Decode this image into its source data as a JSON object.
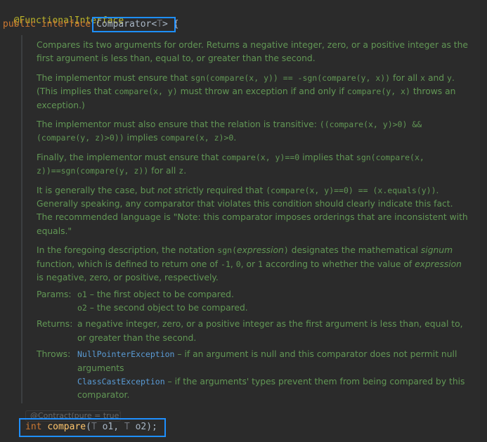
{
  "editor": {
    "annotation": "@FunctionalInterface",
    "decl_keyword1": "public",
    "decl_keyword2": "interface",
    "class_name": "Comparator",
    "type_param_open": "<",
    "type_param": "T",
    "type_param_close": ">",
    "brace": " {",
    "contract_hint": "@Contract(pure = true)",
    "method_return_type": "int",
    "method_name": "compare",
    "method_paren_open": "(",
    "param1_type": "T",
    "param1_name": "o1",
    "comma": ", ",
    "param2_type": "T",
    "param2_name": "o2",
    "method_end": ");"
  },
  "doc": {
    "p1": "Compares its two arguments for order. Returns a negative integer, zero, or a positive integer as the first argument is less than, equal to, or greater than the second.",
    "p2_a": "The implementor must ensure that ",
    "p2_code1": "sgn(compare(x, y)) == -sgn(compare(y, x))",
    "p2_b": " for all ",
    "p2_c1": "x",
    "p2_and": " and ",
    "p2_c2": "y",
    "p2_c": ". (This implies that ",
    "p2_code2": "compare(x, y)",
    "p2_d": " must throw an exception if and only if ",
    "p2_code3": "compare(y, x)",
    "p2_e": " throws an exception.)",
    "p3_a": "The implementor must also ensure that the relation is transitive: ",
    "p3_code1": "((compare(x, y)>0) && (compare(y, z)>0))",
    "p3_b": " implies ",
    "p3_code2": "compare(x, z)>0",
    "p3_c": ".",
    "p4_a": "Finally, the implementor must ensure that ",
    "p4_code1": "compare(x, y)==0",
    "p4_b": " implies that ",
    "p4_code2": "sgn(compare(x, z))==sgn(compare(y, z))",
    "p4_c": " for all ",
    "p4_code3": "z",
    "p4_d": ".",
    "p5_a": "It is generally the case, but ",
    "p5_em": "not",
    "p5_b": " strictly required that ",
    "p5_code1": "(compare(x, y)==0) == (x.equals(y))",
    "p5_c": ". Generally speaking, any comparator that violates this condition should clearly indicate this fact. The recommended language is \"Note: this comparator imposes orderings that are inconsistent with equals.\"",
    "p6_a": "In the foregoing description, the notation ",
    "p6_code1": "sgn(",
    "p6_em1": "expression",
    "p6_code2": ")",
    "p6_b": " designates the mathematical ",
    "p6_em2": "signum",
    "p6_c": " function, which is defined to return one of ",
    "p6_code3": "-1",
    "p6_d": ", ",
    "p6_code4": "0",
    "p6_e": ", or ",
    "p6_code5": "1",
    "p6_f": " according to whether the value of ",
    "p6_em3": "expression",
    "p6_g": " is negative, zero, or positive, respectively.",
    "params_label": "Params:",
    "param1_name": "o1",
    "param1_desc": " – the first object to be compared.",
    "param2_name": "o2",
    "param2_desc": " – the second object to be compared.",
    "returns_label": "Returns:",
    "returns_desc": "a negative integer, zero, or a positive integer as the first argument is less than, equal to, or greater than the second.",
    "throws_label": "Throws:",
    "throws1_link": "NullPointerException",
    "throws1_desc": " – if an argument is null and this comparator does not permit null arguments",
    "throws2_link": "ClassCastException",
    "throws2_desc": " – if the arguments' types prevent them from being compared by this comparator."
  },
  "colors": {
    "background": "#2b2b2b",
    "highlight_box": "#1e8fff",
    "doc_text": "#629755",
    "link": "#5a9bd5"
  }
}
